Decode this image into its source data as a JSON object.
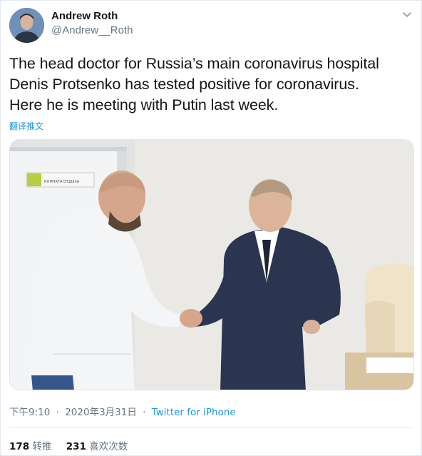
{
  "author": {
    "name": "Andrew Roth",
    "handle": "@Andrew__Roth"
  },
  "tweet": {
    "lines": [
      "The head doctor for Russia’s main coronavirus hospital",
      "Denis Protsenko has tested positive for coronavirus.",
      "Here he is meeting with Putin last week."
    ],
    "translate_label": "翻译推文"
  },
  "media": {
    "sign_text": "КОМНАТА ОТДЫХА"
  },
  "meta": {
    "time": "下午9:10",
    "separator": "·",
    "date": "2020年3月31日",
    "source": "Twitter for iPhone"
  },
  "stats": {
    "retweets_count": "178",
    "retweets_label": "转推",
    "likes_count": "231",
    "likes_label": "喜欢次数"
  },
  "icons": {
    "caret": "chevron-down-icon"
  },
  "colors": {
    "link": "#1b95e0",
    "secondary_text": "#657786",
    "primary_text": "#14171a"
  }
}
